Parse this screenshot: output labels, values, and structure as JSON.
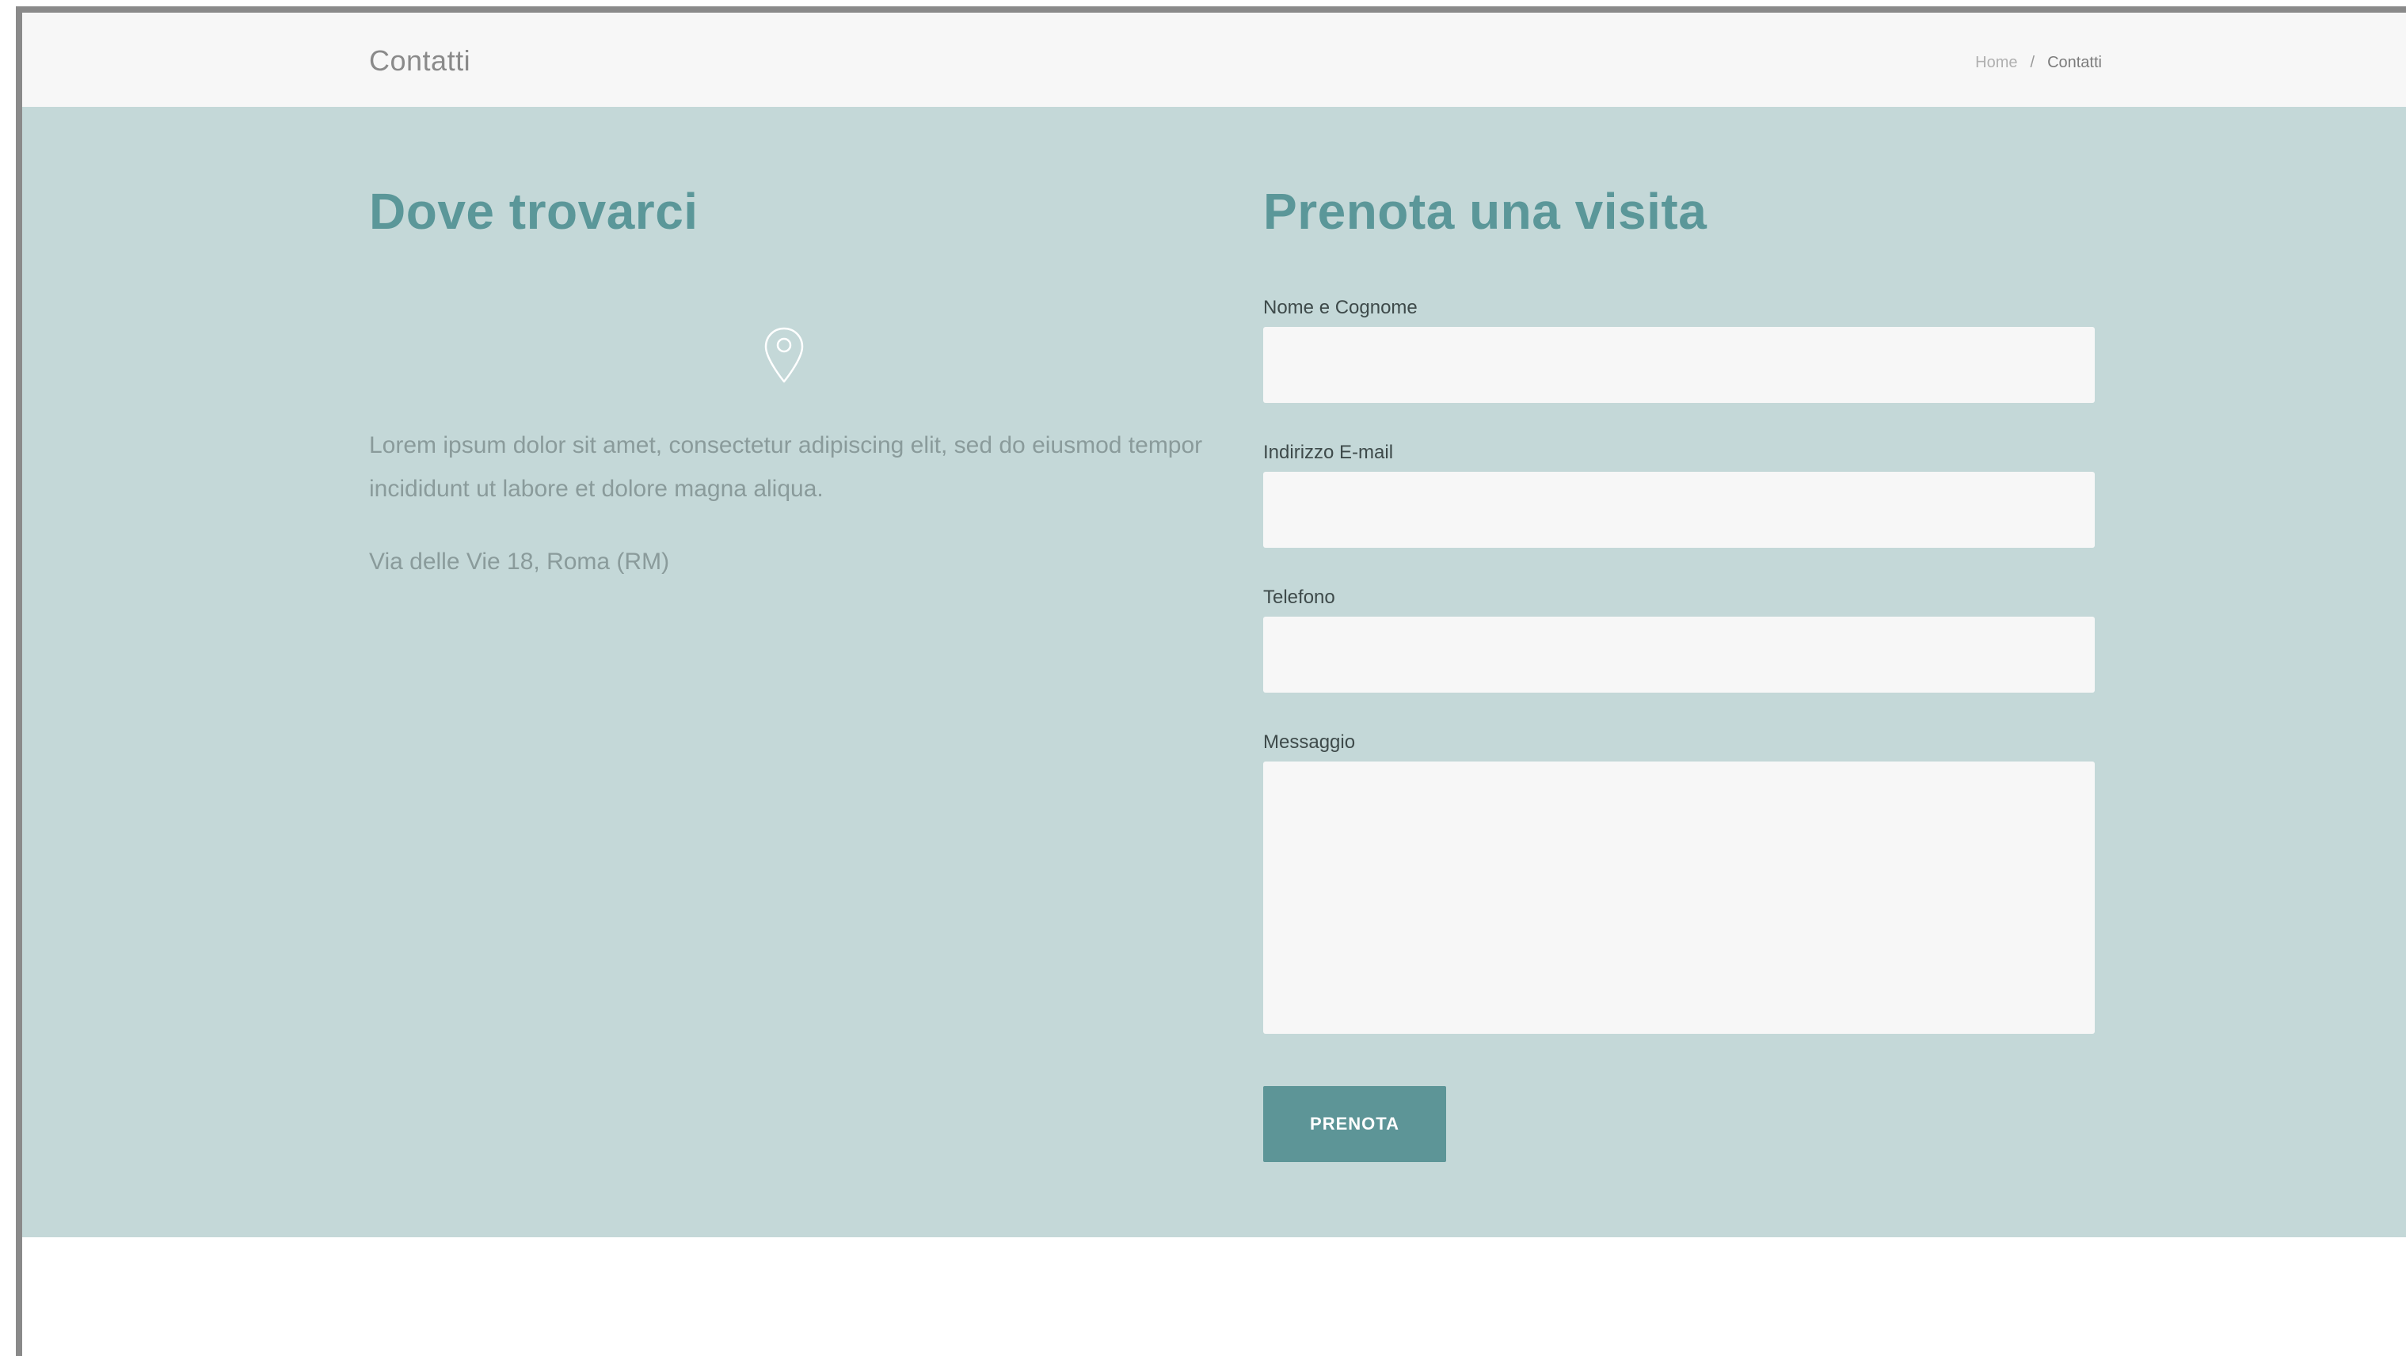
{
  "header": {
    "title": "Contatti",
    "breadcrumb": {
      "home": "Home",
      "separator": "/",
      "current": "Contatti"
    }
  },
  "location": {
    "heading": "Dove trovarci",
    "icon": "map-pin-icon",
    "description": "Lorem ipsum dolor sit amet, consectetur adipiscing elit, sed do eiusmod tempor incididunt ut labore et dolore magna aliqua.",
    "address": "Via delle Vie 18, Roma (RM)"
  },
  "booking_form": {
    "heading": "Prenota una visita",
    "fields": {
      "name": {
        "label": "Nome e Cognome",
        "value": "",
        "placeholder": ""
      },
      "email": {
        "label": "Indirizzo E-mail",
        "value": "",
        "placeholder": ""
      },
      "phone": {
        "label": "Telefono",
        "value": "",
        "placeholder": ""
      },
      "message": {
        "label": "Messaggio",
        "value": "",
        "placeholder": ""
      }
    },
    "submit_label": "PRENOTA"
  },
  "colors": {
    "header_background": "#f7f7f7",
    "section_background": "#c4d8d8",
    "accent": "#5b9799",
    "button_background": "#5d9597",
    "input_background": "#f7f7f7"
  }
}
